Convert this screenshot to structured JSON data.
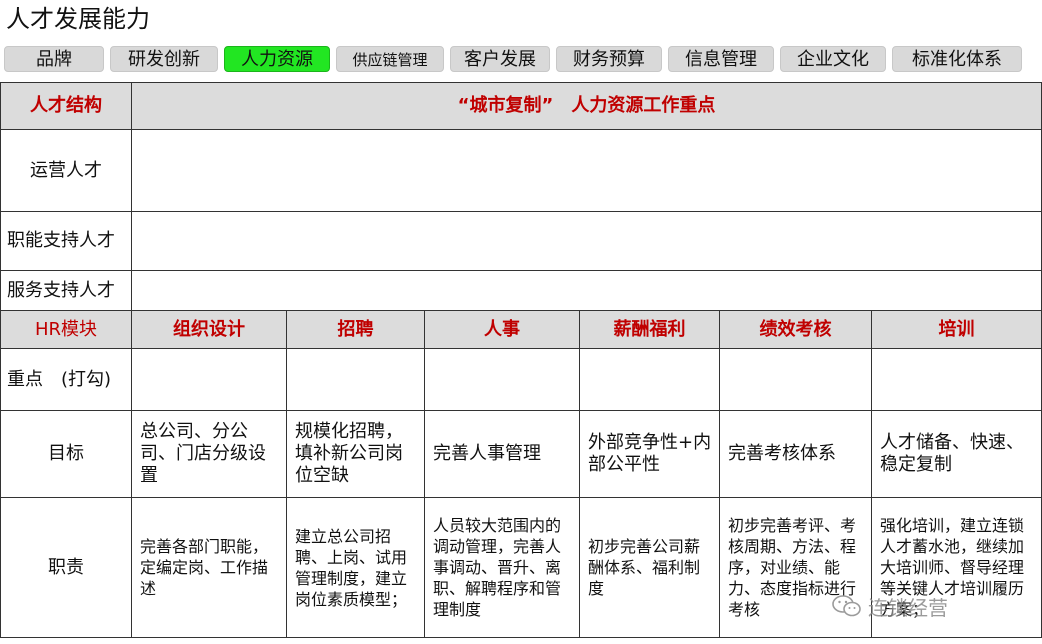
{
  "title": "人才发展能力",
  "tabs": [
    {
      "label": "品牌",
      "active": false
    },
    {
      "label": "研发创新",
      "active": false
    },
    {
      "label": "人力资源",
      "active": true
    },
    {
      "label": "供应链管理",
      "active": false
    },
    {
      "label": "客户发展",
      "active": false
    },
    {
      "label": "财务预算",
      "active": false
    },
    {
      "label": "信息管理",
      "active": false
    },
    {
      "label": "企业文化",
      "active": false
    },
    {
      "label": "标准化体系",
      "active": false
    }
  ],
  "colors": {
    "active_tab": "#22e622",
    "header_text": "#c00000",
    "header_bg": "#dcdcdc"
  },
  "table": {
    "talent_header": "人才结构",
    "focus_header": "“城市复制”　人力资源工作重点",
    "talent_rows": [
      "运营人才",
      "职能支持人才",
      "服务支持人才"
    ],
    "hr_header": "HR模块",
    "modules": [
      "组织设计",
      "招聘",
      "人事",
      "薪酬福利",
      "绩效考核",
      "培训"
    ],
    "rows": [
      {
        "label": "重点　(打勾)",
        "cells": [
          "",
          "",
          "",
          "",
          "",
          ""
        ]
      },
      {
        "label": "目标",
        "cells": [
          "总公司、分公司、门店分级设置",
          "规模化招聘，填补新公司岗位空缺",
          "完善人事管理",
          "外部竞争性+内部公平性",
          "完善考核体系",
          "人才储备、快速、稳定复制"
        ]
      },
      {
        "label": "职责",
        "cells": [
          "完善各部门职能，定编定岗、工作描述",
          "建立总公司招聘、上岗、试用管理制度，建立岗位素质模型；",
          "人员较大范围内的调动管理，完善人事调动、晋升、离职、解聘程序和管理制度",
          "初步完善公司薪酬体系、福利制度",
          "初步完善考评、考核周期、方法、程序，对业绩、能力、态度指标进行考核",
          "强化培训，建立连锁人才蓄水池，继续加大培训师、督导经理等关键人才培训履历方案；"
        ]
      }
    ]
  },
  "watermark": {
    "text": "连锁经营",
    "icon": "wechat-icon"
  }
}
